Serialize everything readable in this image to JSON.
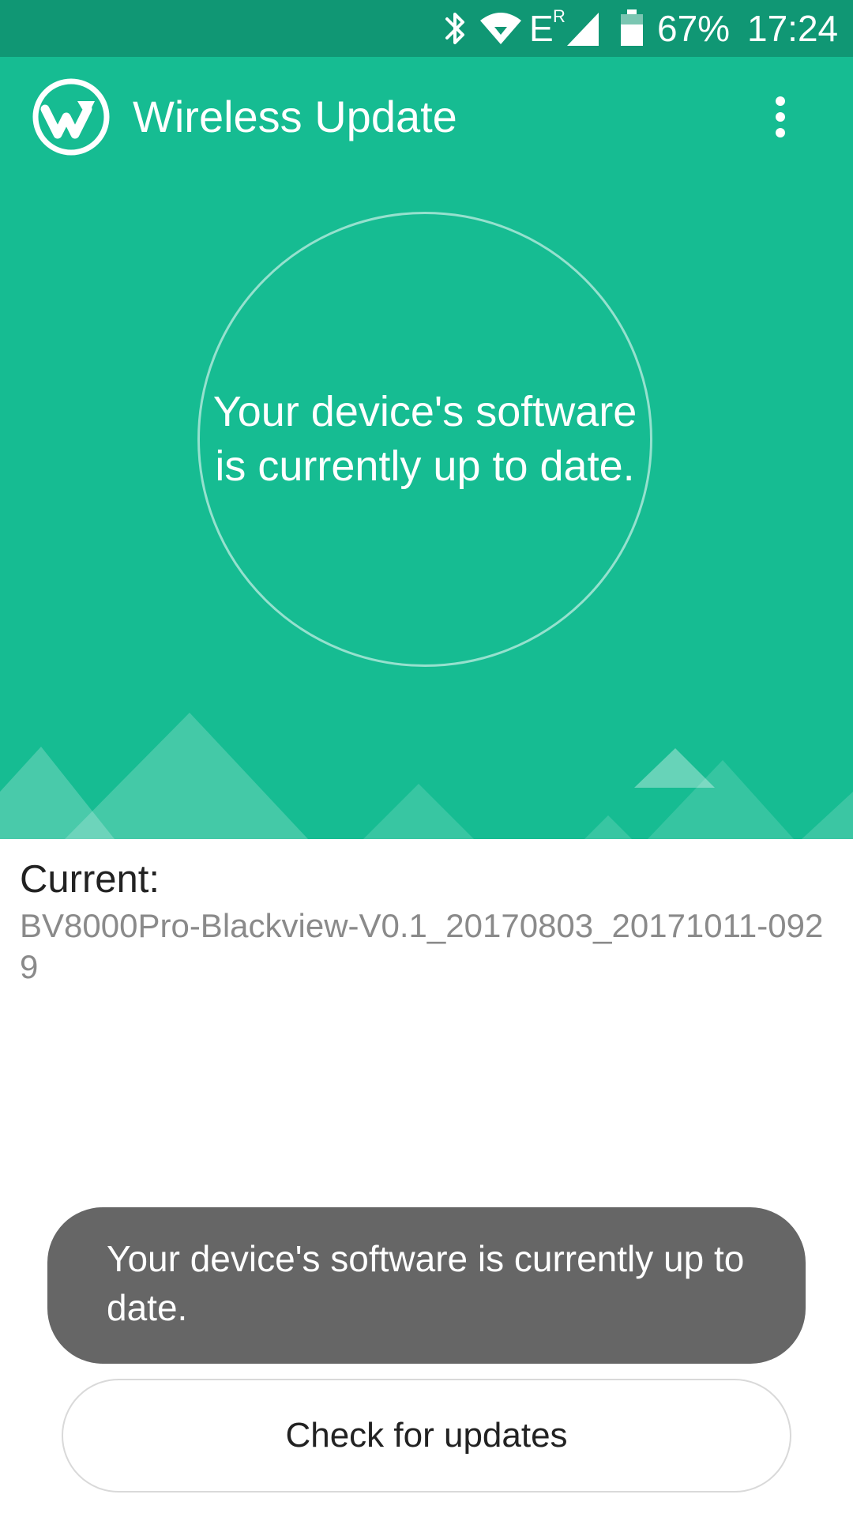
{
  "status_bar": {
    "battery_percent": "67%",
    "clock": "17:24",
    "network_type": "E",
    "roaming_indicator": "R",
    "icons": [
      "bluetooth-icon",
      "wifi-icon",
      "signal-icon",
      "battery-icon"
    ],
    "battery_level": 0.67
  },
  "app_bar": {
    "title": "Wireless Update",
    "logo_icon": "wireless-update-logo-icon",
    "menu_icon": "more-vert-icon"
  },
  "hero": {
    "status_message": "Your device's software is currently up to date."
  },
  "version": {
    "label": "Current:",
    "value": "BV8000Pro-Blackview-V0.1_20170803_20171011-0929"
  },
  "toast": {
    "message": "Your device's software is currently up to date."
  },
  "actions": {
    "check_updates_label": "Check for updates"
  },
  "colors": {
    "status_bar": "#109774",
    "primary": "#16bc92",
    "toast_background": "#666666",
    "version_text": "#8a8a8a"
  }
}
